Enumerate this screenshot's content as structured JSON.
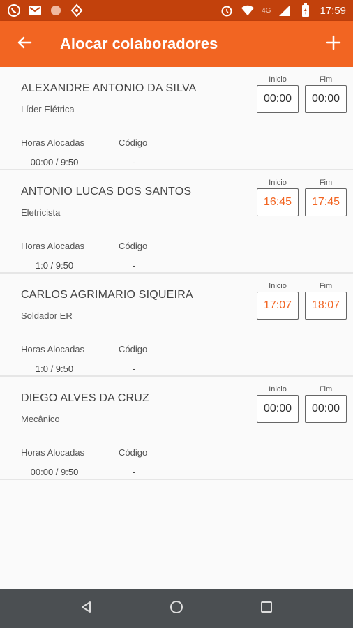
{
  "status_bar": {
    "time": "17:59",
    "network": "4G",
    "icons": [
      "whatsapp-icon",
      "gmail-icon",
      "app-icon",
      "location-icon",
      "alarm-icon",
      "wifi-icon",
      "signal-icon",
      "battery-icon"
    ]
  },
  "app_bar": {
    "title": "Alocar colaboradores",
    "back_icon": "arrow-back-icon",
    "add_icon": "plus-icon"
  },
  "colors": {
    "accent": "#f26522",
    "status_bar": "#c2410c",
    "nav_bar": "#4b4f52"
  },
  "labels": {
    "start": "Inicio",
    "end": "Fim",
    "hours": "Horas Alocadas",
    "code": "Código"
  },
  "employees": [
    {
      "name": "ALEXANDRE ANTONIO DA SILVA",
      "role": "Líder Elétrica",
      "start": "00:00",
      "end": "00:00",
      "hours": "00:00 / 9:50",
      "code": "-",
      "active": false
    },
    {
      "name": "ANTONIO LUCAS DOS SANTOS",
      "role": "Eletricista",
      "start": "16:45",
      "end": "17:45",
      "hours": "1:0 / 9:50",
      "code": "-",
      "active": true
    },
    {
      "name": "CARLOS AGRIMARIO SIQUEIRA",
      "role": "Soldador ER",
      "start": "17:07",
      "end": "18:07",
      "hours": "1:0 / 9:50",
      "code": "-",
      "active": true
    },
    {
      "name": "DIEGO ALVES DA CRUZ",
      "role": "Mecânico",
      "start": "00:00",
      "end": "00:00",
      "hours": "00:00 / 9:50",
      "code": "-",
      "active": false
    }
  ],
  "nav_bar": {
    "icons": [
      "back-triangle-icon",
      "home-circle-icon",
      "recents-square-icon"
    ]
  }
}
